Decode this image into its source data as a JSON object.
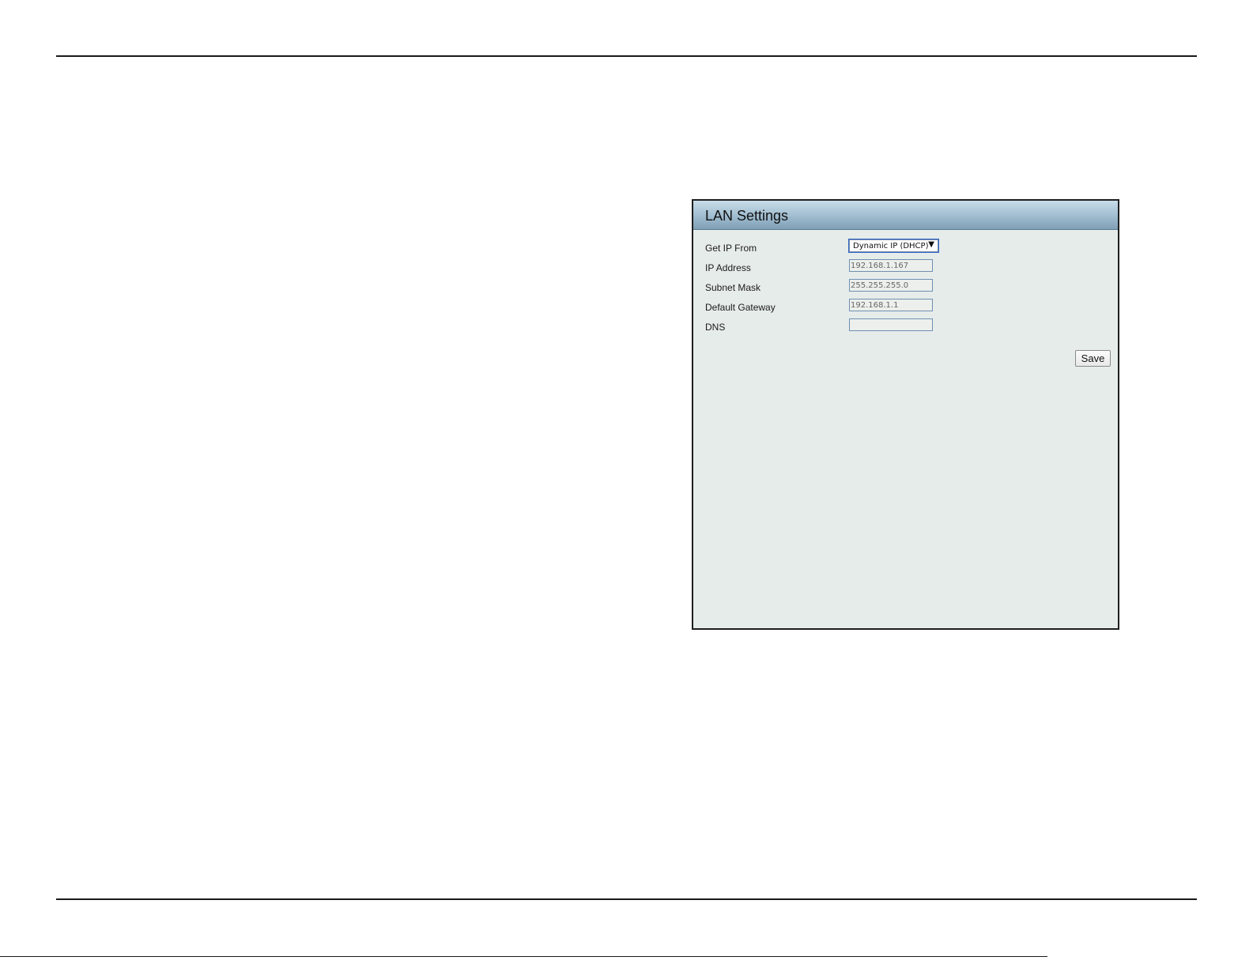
{
  "panel": {
    "title": "LAN Settings"
  },
  "form": {
    "get_ip_from": {
      "label": "Get IP From",
      "selected": "Dynamic IP (DHCP)"
    },
    "ip_address": {
      "label": "IP Address",
      "value": "192.168.1.167"
    },
    "subnet_mask": {
      "label": "Subnet Mask",
      "value": "255.255.255.0"
    },
    "default_gateway": {
      "label": "Default Gateway",
      "value": "192.168.1.1"
    },
    "dns": {
      "label": "DNS",
      "value": ""
    }
  },
  "actions": {
    "save_label": "Save"
  },
  "icons": {
    "dropdown": "chevron-down-icon"
  },
  "colors": {
    "panel_background": "#e6ecea",
    "header_gradient_top": "#c8dce8",
    "header_gradient_bottom": "#7f9fb6",
    "input_border": "#6f8fb3",
    "select_focus": "#2f65c9"
  }
}
